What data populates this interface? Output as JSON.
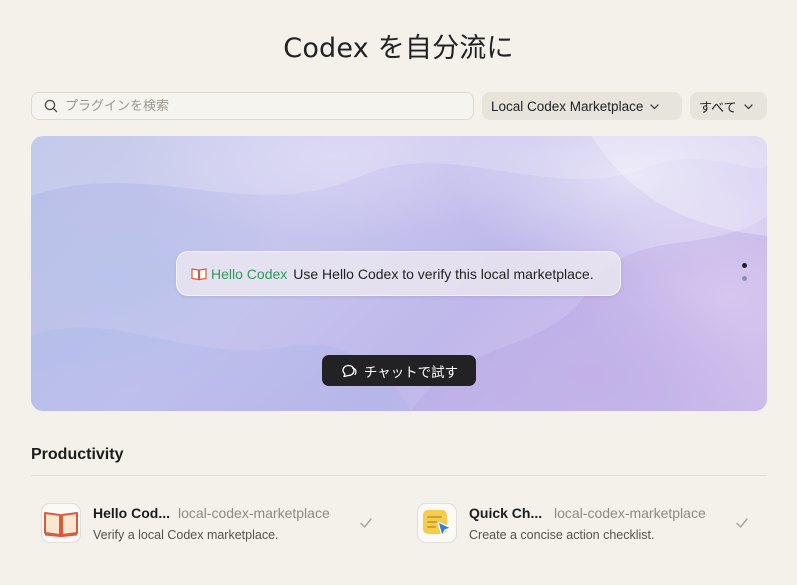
{
  "header": {
    "title": "Codex を自分流に"
  },
  "search": {
    "placeholder": "プラグインを検索",
    "value": ""
  },
  "filters": {
    "marketplace": "Local Codex Marketplace",
    "scope": "すべて"
  },
  "hero": {
    "mention": "Hello Codex",
    "prompt": "Use Hello Codex to verify this local marketplace.",
    "try_button": "チャットで試す",
    "carousel": {
      "total": 2,
      "active_index": 0
    }
  },
  "section": {
    "title": "Productivity",
    "plugins": [
      {
        "name": "Hello Cod...",
        "source": "local-codex-marketplace",
        "description": "Verify a local Codex marketplace.",
        "icon": "open-book-icon",
        "installed": true
      },
      {
        "name": "Quick Ch...",
        "source": "local-codex-marketplace",
        "description": "Create a concise action checklist.",
        "icon": "checklist-cursor-icon",
        "installed": true
      }
    ]
  },
  "colors": {
    "background": "#f3f1ea",
    "mention": "#2f9a5a",
    "button": "#222224",
    "book_accent": "#d95a3c"
  }
}
